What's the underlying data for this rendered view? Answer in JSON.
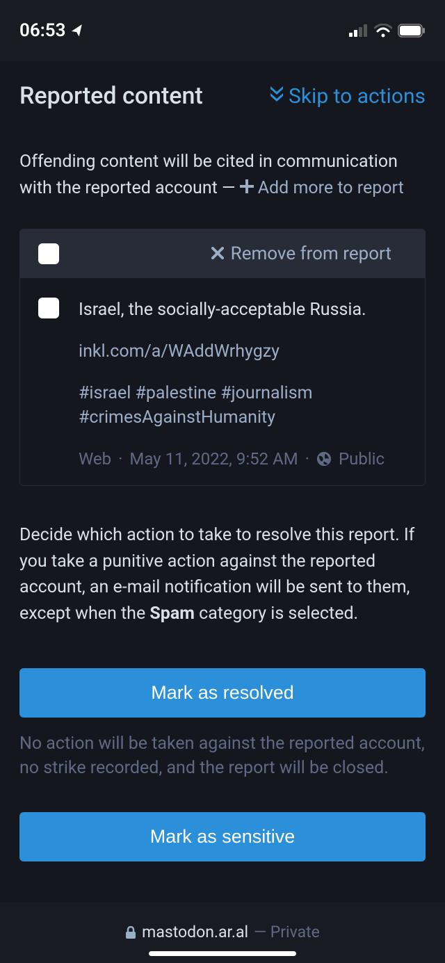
{
  "statusBar": {
    "time": "06:53"
  },
  "header": {
    "title": "Reported content",
    "skipLabel": "Skip to actions"
  },
  "intro": {
    "text": "Offending content will be cited in communication with the reported account — ",
    "addMoreLabel": "Add more to report"
  },
  "reportItem": {
    "removeLabel": "Remove from report",
    "postText": "Israel, the socially-acceptable Russia.",
    "postLink": "inkl.com/a/WAddWrhygzy",
    "postTags": "#israel #palestine #journalism #crimesAgainstHumanity",
    "metaSource": "Web",
    "metaDate": "May 11, 2022, 9:52 AM",
    "metaVisibility": "Public"
  },
  "actions": {
    "introPrefix": "Decide which action to take to resolve this report. If you take a punitive action against the reported account, an e-mail notification will be sent to them, except when the ",
    "introBold": "Spam",
    "introSuffix": " category is selected.",
    "resolveLabel": "Mark as resolved",
    "resolveDesc": "No action will be taken against the reported account, no strike recorded, and the report will be closed.",
    "sensitiveLabel": "Mark as sensitive"
  },
  "bottomBar": {
    "domain": "mastodon.ar.al",
    "mode": "— Private"
  }
}
